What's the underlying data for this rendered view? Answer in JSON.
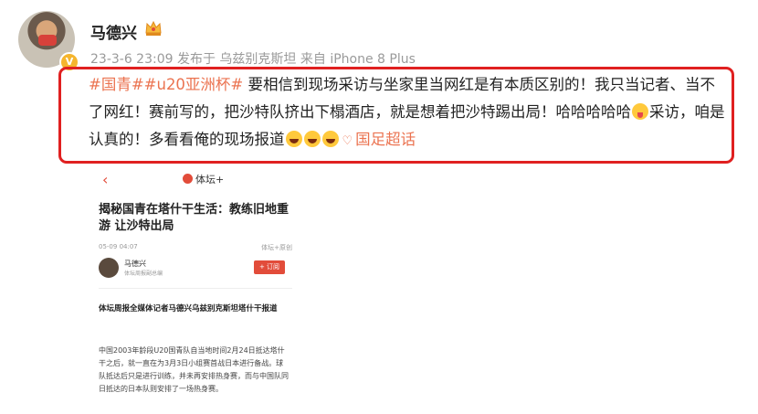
{
  "post": {
    "username": "马德兴",
    "meta": "23-3-6 23:09  发布于 乌兹别克斯坦  来自 iPhone 8 Plus",
    "verified_badge": "V",
    "content": {
      "tag1": "#国青#",
      "tag2": "#u20亚洲杯#",
      "text1": " 要相信到现场采访与坐家里当网红是有本质区别的！我只当记者、当不了网红！赛前写的，把沙特队挤出下榻酒店，就是想着把沙特踢出局！哈哈哈哈哈",
      "text2": "采访，咱是认真的！多看看俺的现场报道",
      "link_text": "国足超话"
    },
    "emoji_names": [
      "tongue-face-emoji",
      "laughing-emoji",
      "laughing-emoji",
      "laughing-emoji"
    ]
  },
  "embedded_article": {
    "back_icon": "‹",
    "brand": "体坛+",
    "title": "揭秘国青在塔什干生活：教练旧地重游 让沙特出局",
    "date": "05-09 04:07",
    "source": "体坛+原创",
    "author_name": "马德兴",
    "author_sub": "体坛周报副总编",
    "follow_label": "+ 订阅",
    "lead": "体坛周报全媒体记者马德兴乌兹别克斯坦塔什干报道",
    "body": "中国2003年龄段U20国青队自当地时间2月24日抵达塔什干之后，就一直在为3月3日小组赛首战日本进行备战。球队抵达后只是进行训练，并未再安排热身赛，而与中国队同日抵达的日本队则安排了一场热身赛。"
  },
  "colors": {
    "accent": "#eb7350",
    "highlight_box": "#e02020",
    "brand_red": "#e24c3a"
  }
}
